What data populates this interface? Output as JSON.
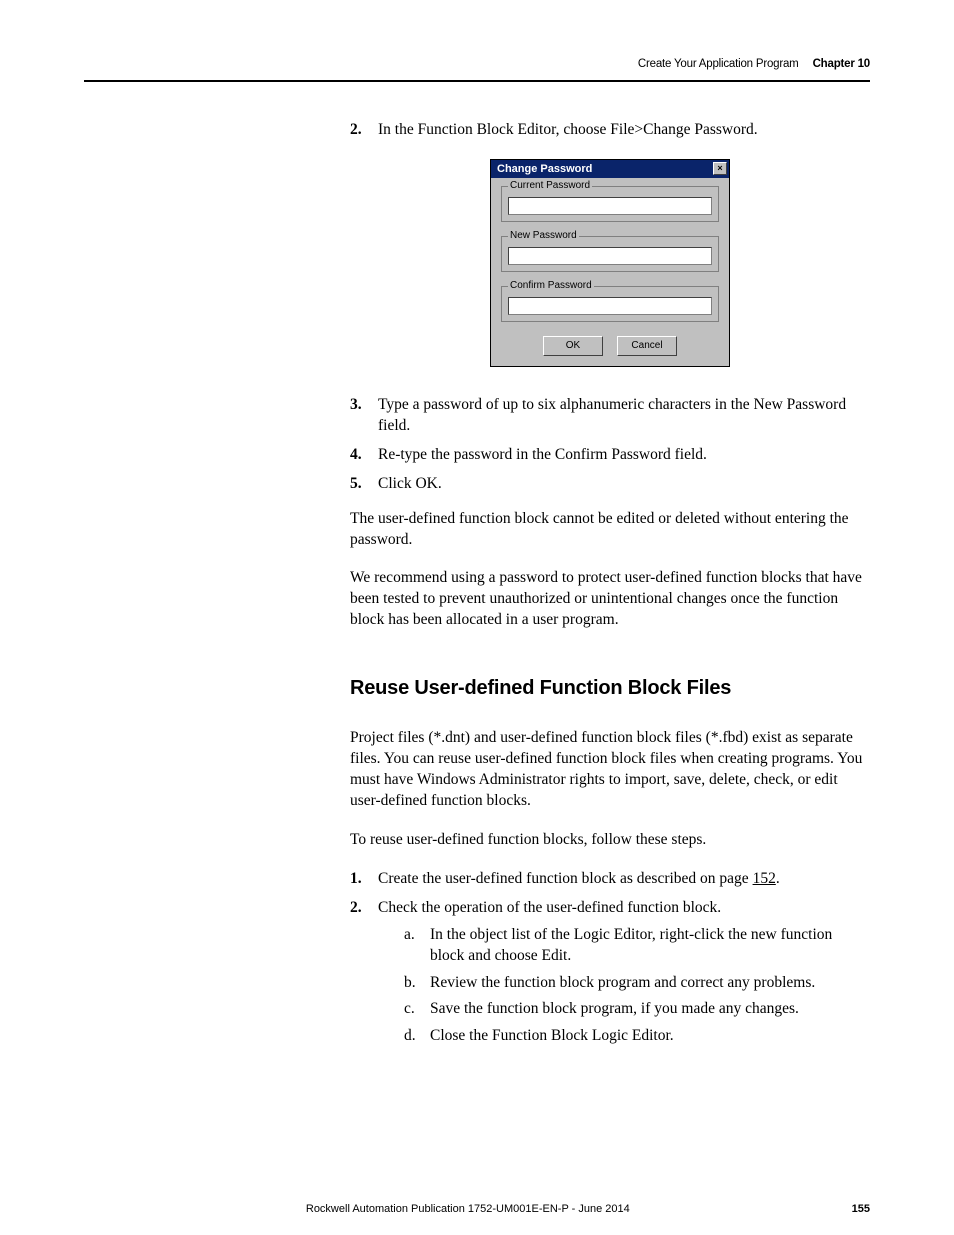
{
  "header": {
    "section": "Create Your Application Program",
    "chapter": "Chapter 10"
  },
  "steps_a": [
    {
      "n": "2.",
      "t": "In the Function Block Editor, choose File>Change Password."
    }
  ],
  "dialog": {
    "title": "Change Password",
    "close": "×",
    "current": "Current Password",
    "new": "New Password",
    "confirm": "Confirm Password",
    "ok": "OK",
    "cancel": "Cancel"
  },
  "steps_b": [
    {
      "n": "3.",
      "t": "Type a password of up to six alphanumeric characters in the New Password field."
    },
    {
      "n": "4.",
      "t": "Re-type the password in the Confirm Password field."
    },
    {
      "n": "5.",
      "t": "Click OK."
    }
  ],
  "para1": "The user-defined function block cannot be edited or deleted without entering the password.",
  "para2": "We recommend using a password to protect user-defined function blocks that have been tested to prevent unauthorized or unintentional changes once the function block has been allocated in a user program.",
  "heading": "Reuse User-defined Function Block Files",
  "para3": "Project files (*.dnt) and user-defined function block files (*.fbd) exist as separate files. You can reuse user-defined function block files when creating programs. You must have Windows Administrator rights to import, save, delete, check, or edit user-defined function blocks.",
  "para4": "To reuse user-defined function blocks, follow these steps.",
  "steps_c": [
    {
      "n": "1.",
      "pre": "Create the user-defined function block as described on page ",
      "link": "152",
      "post": "."
    },
    {
      "n": "2.",
      "t": "Check the operation of the user-defined function block."
    }
  ],
  "substeps": [
    {
      "n": "a.",
      "t": "In the object list of the Logic Editor, right-click the new function block and choose Edit."
    },
    {
      "n": "b.",
      "t": "Review the function block program and correct any problems."
    },
    {
      "n": "c.",
      "t": "Save the function block program, if you made any changes."
    },
    {
      "n": "d.",
      "t": "Close the Function Block Logic Editor."
    }
  ],
  "footer": {
    "pub": "Rockwell Automation Publication 1752-UM001E-EN-P - June 2014",
    "page": "155"
  }
}
